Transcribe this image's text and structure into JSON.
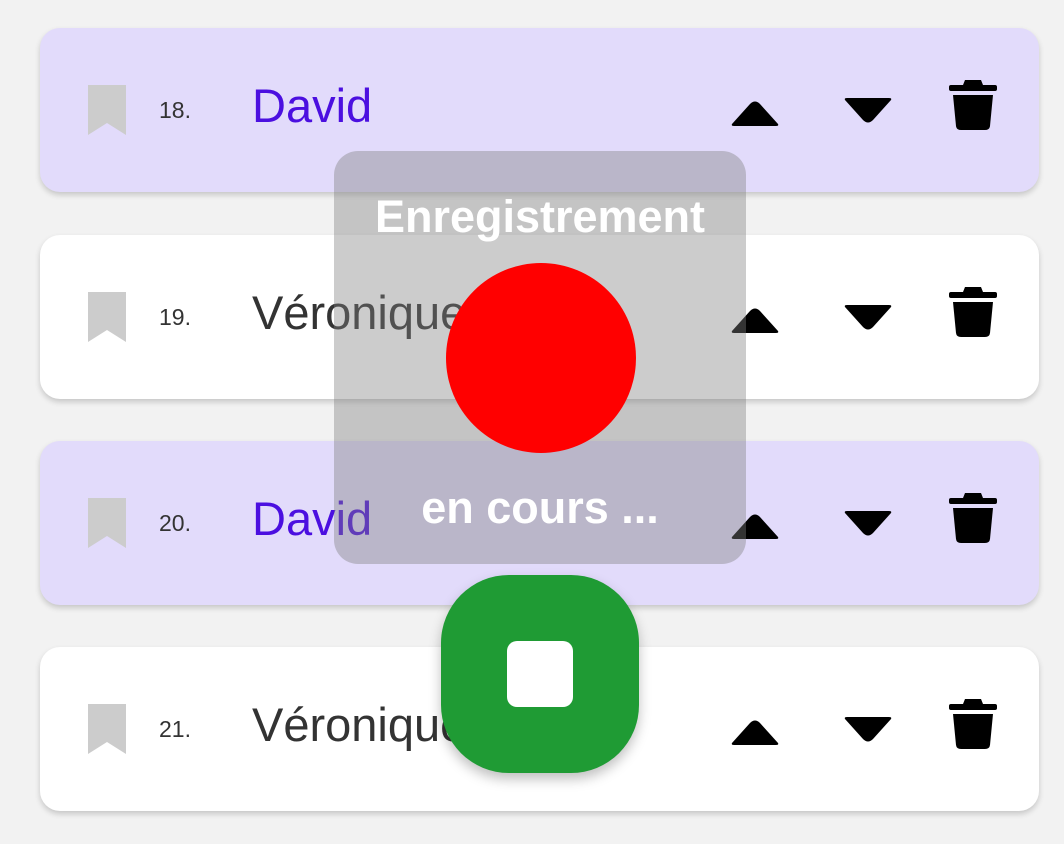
{
  "rows": [
    {
      "number": "18.",
      "name": "David",
      "highlighted": true
    },
    {
      "number": "19.",
      "name": "Véronique",
      "highlighted": false
    },
    {
      "number": "20.",
      "name": "David",
      "highlighted": true
    },
    {
      "number": "21.",
      "name": "Véronique",
      "highlighted": false
    }
  ],
  "icons": {
    "bookmark": "bookmark-icon",
    "move_up": "triangle-up-icon",
    "move_down": "triangle-down-icon",
    "delete": "trash-icon"
  },
  "recording": {
    "title": "Enregistrement",
    "status": "en cours ...",
    "indicator_color": "#ff0000",
    "stop_button_color": "#1f9b34"
  },
  "colors": {
    "highlight_background": "#e2dbfb",
    "highlight_text": "#4b0fe0",
    "bookmark": "#cccccc"
  }
}
